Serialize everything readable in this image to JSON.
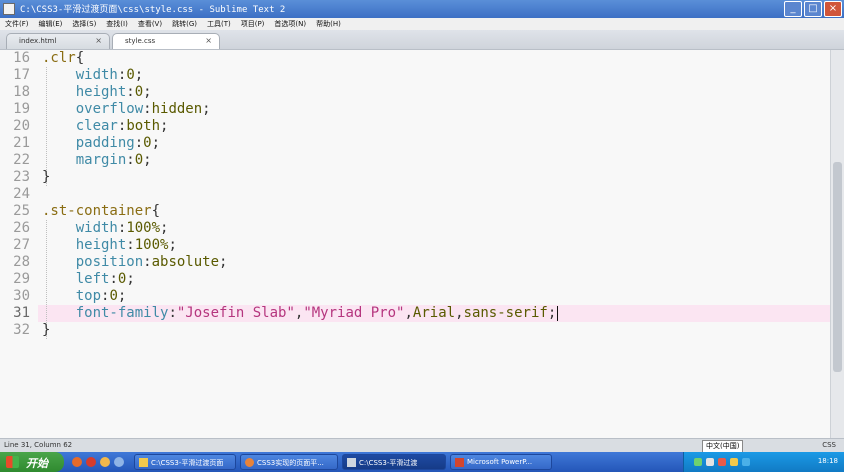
{
  "window": {
    "title": "C:\\CSS3-平滑过渡页面\\css\\style.css - Sublime Text 2",
    "buttons": {
      "minimize": "_",
      "maximize": "□",
      "close": "×"
    }
  },
  "menu": [
    "文件(F)",
    "编辑(E)",
    "选择(S)",
    "查找(I)",
    "查看(V)",
    "跳转(G)",
    "工具(T)",
    "项目(P)",
    "首选项(N)",
    "帮助(H)"
  ],
  "tabs": [
    {
      "label": "index.html",
      "close": "×",
      "active": false
    },
    {
      "label": "style.css",
      "close": "×",
      "active": true
    }
  ],
  "editor": {
    "current_line": 31,
    "lines": [
      {
        "n": "16",
        "tokens": [
          {
            "t": ".clr",
            "c": "sel"
          },
          {
            "t": "{",
            "c": "pun"
          }
        ]
      },
      {
        "n": "17",
        "tokens": [
          {
            "t": "    ",
            "c": "pun"
          },
          {
            "t": "width",
            "c": "prop"
          },
          {
            "t": ":",
            "c": "pun"
          },
          {
            "t": "0",
            "c": "val"
          },
          {
            "t": ";",
            "c": "pun"
          }
        ]
      },
      {
        "n": "18",
        "tokens": [
          {
            "t": "    ",
            "c": "pun"
          },
          {
            "t": "height",
            "c": "prop"
          },
          {
            "t": ":",
            "c": "pun"
          },
          {
            "t": "0",
            "c": "val"
          },
          {
            "t": ";",
            "c": "pun"
          }
        ]
      },
      {
        "n": "19",
        "tokens": [
          {
            "t": "    ",
            "c": "pun"
          },
          {
            "t": "overflow",
            "c": "prop"
          },
          {
            "t": ":",
            "c": "pun"
          },
          {
            "t": "hidden",
            "c": "val"
          },
          {
            "t": ";",
            "c": "pun"
          }
        ]
      },
      {
        "n": "20",
        "tokens": [
          {
            "t": "    ",
            "c": "pun"
          },
          {
            "t": "clear",
            "c": "prop"
          },
          {
            "t": ":",
            "c": "pun"
          },
          {
            "t": "both",
            "c": "val"
          },
          {
            "t": ";",
            "c": "pun"
          }
        ]
      },
      {
        "n": "21",
        "tokens": [
          {
            "t": "    ",
            "c": "pun"
          },
          {
            "t": "padding",
            "c": "prop"
          },
          {
            "t": ":",
            "c": "pun"
          },
          {
            "t": "0",
            "c": "val"
          },
          {
            "t": ";",
            "c": "pun"
          }
        ]
      },
      {
        "n": "22",
        "tokens": [
          {
            "t": "    ",
            "c": "pun"
          },
          {
            "t": "margin",
            "c": "prop"
          },
          {
            "t": ":",
            "c": "pun"
          },
          {
            "t": "0",
            "c": "val"
          },
          {
            "t": ";",
            "c": "pun"
          }
        ]
      },
      {
        "n": "23",
        "tokens": [
          {
            "t": "}",
            "c": "pun"
          }
        ]
      },
      {
        "n": "24",
        "tokens": []
      },
      {
        "n": "25",
        "tokens": [
          {
            "t": ".st-container",
            "c": "sel"
          },
          {
            "t": "{",
            "c": "pun"
          }
        ]
      },
      {
        "n": "26",
        "tokens": [
          {
            "t": "    ",
            "c": "pun"
          },
          {
            "t": "width",
            "c": "prop"
          },
          {
            "t": ":",
            "c": "pun"
          },
          {
            "t": "100%",
            "c": "val"
          },
          {
            "t": ";",
            "c": "pun"
          }
        ]
      },
      {
        "n": "27",
        "tokens": [
          {
            "t": "    ",
            "c": "pun"
          },
          {
            "t": "height",
            "c": "prop"
          },
          {
            "t": ":",
            "c": "pun"
          },
          {
            "t": "100%",
            "c": "val"
          },
          {
            "t": ";",
            "c": "pun"
          }
        ]
      },
      {
        "n": "28",
        "tokens": [
          {
            "t": "    ",
            "c": "pun"
          },
          {
            "t": "position",
            "c": "prop"
          },
          {
            "t": ":",
            "c": "pun"
          },
          {
            "t": "absolute",
            "c": "val"
          },
          {
            "t": ";",
            "c": "pun"
          }
        ]
      },
      {
        "n": "29",
        "tokens": [
          {
            "t": "    ",
            "c": "pun"
          },
          {
            "t": "left",
            "c": "prop"
          },
          {
            "t": ":",
            "c": "pun"
          },
          {
            "t": "0",
            "c": "val"
          },
          {
            "t": ";",
            "c": "pun"
          }
        ]
      },
      {
        "n": "30",
        "tokens": [
          {
            "t": "    ",
            "c": "pun"
          },
          {
            "t": "top",
            "c": "prop"
          },
          {
            "t": ":",
            "c": "pun"
          },
          {
            "t": "0",
            "c": "val"
          },
          {
            "t": ";",
            "c": "pun"
          }
        ]
      },
      {
        "n": "31",
        "tokens": [
          {
            "t": "    ",
            "c": "pun"
          },
          {
            "t": "font-family",
            "c": "prop"
          },
          {
            "t": ":",
            "c": "pun"
          },
          {
            "t": "\"Josefin Slab\"",
            "c": "str"
          },
          {
            "t": ",",
            "c": "pun"
          },
          {
            "t": "\"Myriad Pro\"",
            "c": "str"
          },
          {
            "t": ",",
            "c": "pun"
          },
          {
            "t": "Arial",
            "c": "val"
          },
          {
            "t": ",",
            "c": "pun"
          },
          {
            "t": "sans-serif",
            "c": "val"
          },
          {
            "t": ";",
            "c": "pun"
          }
        ]
      },
      {
        "n": "32",
        "tokens": [
          {
            "t": "}",
            "c": "pun"
          }
        ]
      }
    ]
  },
  "status": {
    "position": "Line 31, Column 62",
    "ime": "中文(中国)",
    "syntax": "CSS"
  },
  "taskbar": {
    "start_label": "开始",
    "tasks": [
      {
        "label": "C:\\CSS3-平滑过渡页面",
        "active": false,
        "icon_color": "#f2c94c"
      },
      {
        "label": "CSS3实现的页面平...",
        "active": false,
        "icon_color": "#e8833a"
      },
      {
        "label": "C:\\CSS3-平滑过渡",
        "active": true,
        "icon_color": "#cfd6df"
      },
      {
        "label": "Microsoft PowerP...",
        "active": false,
        "icon_color": "#d2452d"
      }
    ],
    "clock": "18:18"
  },
  "colors": {
    "highlight": "#fbe5f2",
    "selector": "#8a6d13",
    "property": "#3f8aa6",
    "value": "#5a5a00",
    "string": "#b5357e"
  }
}
